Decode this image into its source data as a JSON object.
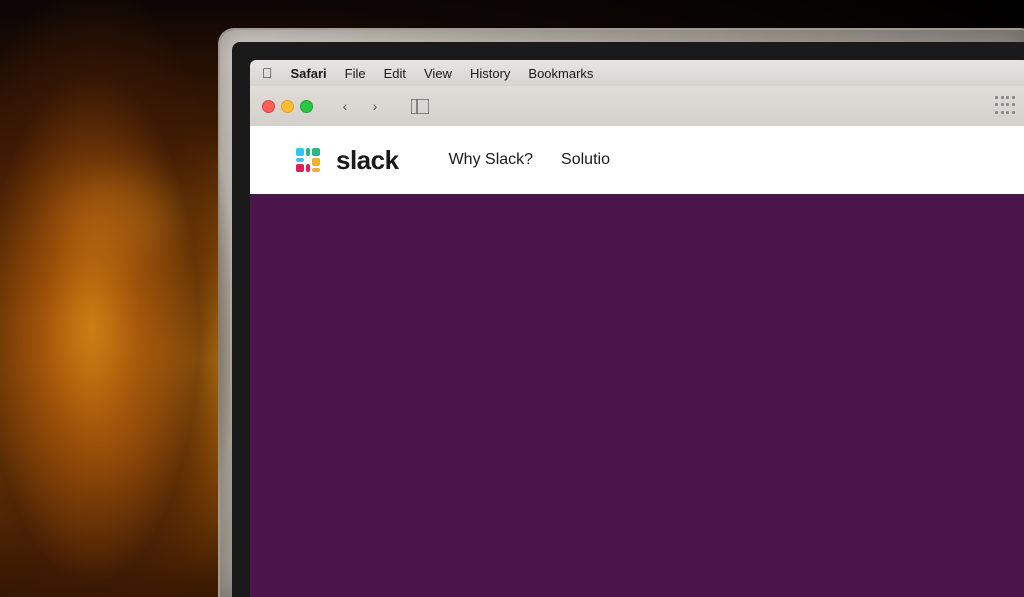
{
  "background": {
    "color": "#1a0a00"
  },
  "menubar": {
    "apple_label": "",
    "items": [
      {
        "label": "Safari",
        "bold": true
      },
      {
        "label": "File"
      },
      {
        "label": "Edit"
      },
      {
        "label": "View"
      },
      {
        "label": "History"
      },
      {
        "label": "Bookmarks"
      }
    ]
  },
  "browser": {
    "back_label": "‹",
    "forward_label": "›",
    "sidebar_icon": "⬜"
  },
  "slack": {
    "name": "slack",
    "nav_links": [
      {
        "label": "Why Slack?"
      },
      {
        "label": "Solutio"
      }
    ],
    "hero_color": "#4a154b"
  },
  "traffic_lights": {
    "red": "red",
    "yellow": "yellow",
    "green": "green"
  }
}
